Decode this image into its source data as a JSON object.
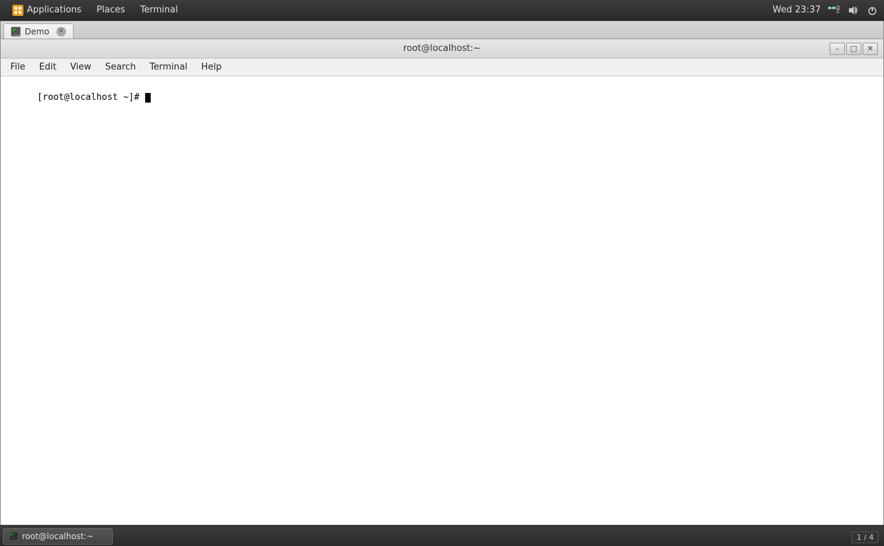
{
  "system_panel": {
    "applications_label": "Applications",
    "places_label": "Places",
    "terminal_label": "Terminal",
    "datetime": "Wed 23:37"
  },
  "terminal_window": {
    "title": "root@localhost:~",
    "tab_label": "Demo",
    "menu_items": [
      "File",
      "Edit",
      "View",
      "Search",
      "Terminal",
      "Help"
    ],
    "prompt": "[root@localhost ~]# ",
    "cursor_visible": true
  },
  "taskbar": {
    "item_label": "root@localhost:~",
    "pager": "1 / 4"
  },
  "title_buttons": {
    "minimize": "–",
    "maximize": "□",
    "close": "✕"
  }
}
